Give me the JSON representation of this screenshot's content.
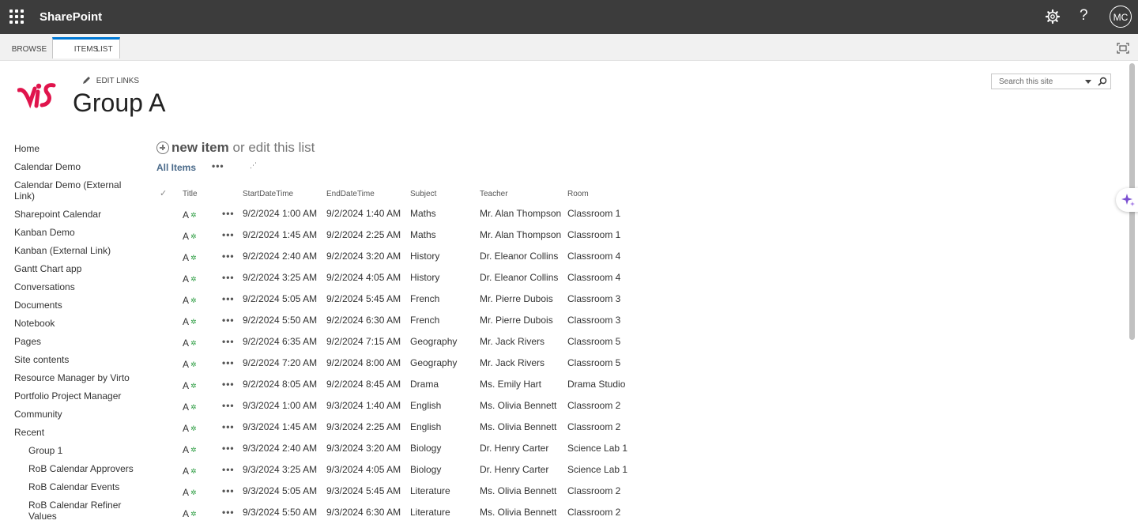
{
  "suite": {
    "app_name": "SharePoint",
    "avatar_initials": "MC",
    "help_symbol": "?"
  },
  "ribbon": {
    "tabs": [
      "BROWSE",
      "ITEMS",
      "LIST"
    ],
    "active_tab": "ITEMS"
  },
  "site": {
    "edit_links": "EDIT LINKS",
    "title": "Group A",
    "search_placeholder": "Search this site"
  },
  "nav": {
    "items": [
      "Home",
      "Calendar Demo",
      "Calendar Demo (External Link)",
      "Sharepoint Calendar",
      "Kanban Demo",
      "Kanban (External Link)",
      "Gantt Chart app",
      "Conversations",
      "Documents",
      "Notebook",
      "Pages",
      "Site contents",
      "Resource Manager by Virto",
      "Portfolio Project Manager",
      "Community",
      "Recent"
    ],
    "recent": [
      "Group 1",
      "RoB Calendar Approvers",
      "RoB Calendar Events",
      "RoB Calendar Refiner Values"
    ]
  },
  "list": {
    "new_item": "new item",
    "or_edit": "or edit this list",
    "view_name": "All Items",
    "view_more": "•••",
    "columns": [
      "Title",
      "StartDateTime",
      "EndDateTime",
      "Subject",
      "Teacher",
      "Room"
    ],
    "rows": [
      {
        "title": "A",
        "start": "9/2/2024 1:00 AM",
        "end": "9/2/2024 1:40 AM",
        "subject": "Maths",
        "teacher": "Mr. Alan Thompson",
        "room": "Classroom 1"
      },
      {
        "title": "A",
        "start": "9/2/2024 1:45 AM",
        "end": "9/2/2024 2:25 AM",
        "subject": "Maths",
        "teacher": "Mr. Alan Thompson",
        "room": "Classroom 1"
      },
      {
        "title": "A",
        "start": "9/2/2024 2:40 AM",
        "end": "9/2/2024 3:20 AM",
        "subject": "History",
        "teacher": "Dr. Eleanor Collins",
        "room": "Classroom 4"
      },
      {
        "title": "A",
        "start": "9/2/2024 3:25 AM",
        "end": "9/2/2024 4:05 AM",
        "subject": "History",
        "teacher": "Dr. Eleanor Collins",
        "room": "Classroom 4"
      },
      {
        "title": "A",
        "start": "9/2/2024 5:05 AM",
        "end": "9/2/2024 5:45 AM",
        "subject": "French",
        "teacher": "Mr. Pierre Dubois",
        "room": "Classroom 3"
      },
      {
        "title": "A",
        "start": "9/2/2024 5:50 AM",
        "end": "9/2/2024 6:30 AM",
        "subject": "French",
        "teacher": "Mr. Pierre Dubois",
        "room": "Classroom 3"
      },
      {
        "title": "A",
        "start": "9/2/2024 6:35 AM",
        "end": "9/2/2024 7:15 AM",
        "subject": "Geography",
        "teacher": "Mr. Jack Rivers",
        "room": "Classroom 5"
      },
      {
        "title": "A",
        "start": "9/2/2024 7:20 AM",
        "end": "9/2/2024 8:00 AM",
        "subject": "Geography",
        "teacher": "Mr. Jack Rivers",
        "room": "Classroom 5"
      },
      {
        "title": "A",
        "start": "9/2/2024 8:05 AM",
        "end": "9/2/2024 8:45 AM",
        "subject": "Drama",
        "teacher": "Ms. Emily Hart",
        "room": "Drama Studio"
      },
      {
        "title": "A",
        "start": "9/3/2024 1:00 AM",
        "end": "9/3/2024 1:40 AM",
        "subject": "English",
        "teacher": "Ms. Olivia Bennett",
        "room": "Classroom 2"
      },
      {
        "title": "A",
        "start": "9/3/2024 1:45 AM",
        "end": "9/3/2024 2:25 AM",
        "subject": "English",
        "teacher": "Ms. Olivia Bennett",
        "room": "Classroom 2"
      },
      {
        "title": "A",
        "start": "9/3/2024 2:40 AM",
        "end": "9/3/2024 3:20 AM",
        "subject": "Biology",
        "teacher": "Dr. Henry Carter",
        "room": "Science Lab 1"
      },
      {
        "title": "A",
        "start": "9/3/2024 3:25 AM",
        "end": "9/3/2024 4:05 AM",
        "subject": "Biology",
        "teacher": "Dr. Henry Carter",
        "room": "Science Lab 1"
      },
      {
        "title": "A",
        "start": "9/3/2024 5:05 AM",
        "end": "9/3/2024 5:45 AM",
        "subject": "Literature",
        "teacher": "Ms. Olivia Bennett",
        "room": "Classroom 2"
      },
      {
        "title": "A",
        "start": "9/3/2024 5:50 AM",
        "end": "9/3/2024 6:30 AM",
        "subject": "Literature",
        "teacher": "Ms. Olivia Bennett",
        "room": "Classroom 2"
      }
    ]
  },
  "icons": {
    "new_item_badge": "new-item-badge-icon",
    "settings": "gear-icon",
    "copilot": "sparkle-icon"
  },
  "colors": {
    "suitebar": "#3c3c3c",
    "active_tab_accent": "#0078d4",
    "brand_logo": "#e0144c",
    "new_badge": "#2f9e44"
  }
}
